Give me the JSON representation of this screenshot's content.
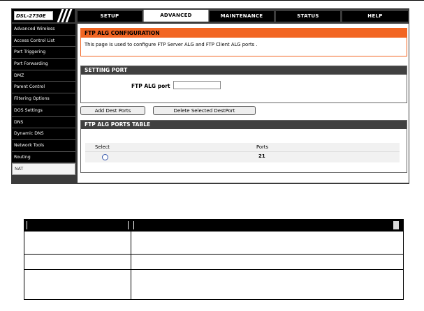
{
  "router": {
    "logo": "DSL-2730E",
    "tabs": [
      {
        "label": "SETUP",
        "active": false
      },
      {
        "label": "ADVANCED",
        "active": true
      },
      {
        "label": "MAINTENANCE",
        "active": false
      },
      {
        "label": "STATUS",
        "active": false
      },
      {
        "label": "HELP",
        "active": false
      }
    ],
    "sidebar": [
      "Advanced Wireless",
      "Access Control List",
      "Port Triggering",
      "Port Forwarding",
      "DMZ",
      "Parent Control",
      "Filtering Options",
      "DOS Settings",
      "DNS",
      "Dynamic DNS",
      "Network Tools",
      "Routing",
      "NAT"
    ],
    "selected_sidebar": "NAT",
    "config": {
      "title": "FTP ALG CONFIGURATION",
      "description": "This page is used to configure FTP Server ALG and FTP Client ALG ports ."
    },
    "setting": {
      "title": "SETTING PORT",
      "port_label": "FTP ALG port",
      "port_value": ""
    },
    "buttons": {
      "add": "Add Dest Ports",
      "delete": "Delete Selected DestPort"
    },
    "ports_table": {
      "title": "FTP ALG PORTS TABLE",
      "columns": [
        "Select",
        "Ports"
      ],
      "rows": [
        {
          "ports": "21"
        }
      ]
    }
  },
  "colors": {
    "accent_orange": "#f26522",
    "panel_dark": "#3b3b3b",
    "header_dark": "#404040"
  }
}
